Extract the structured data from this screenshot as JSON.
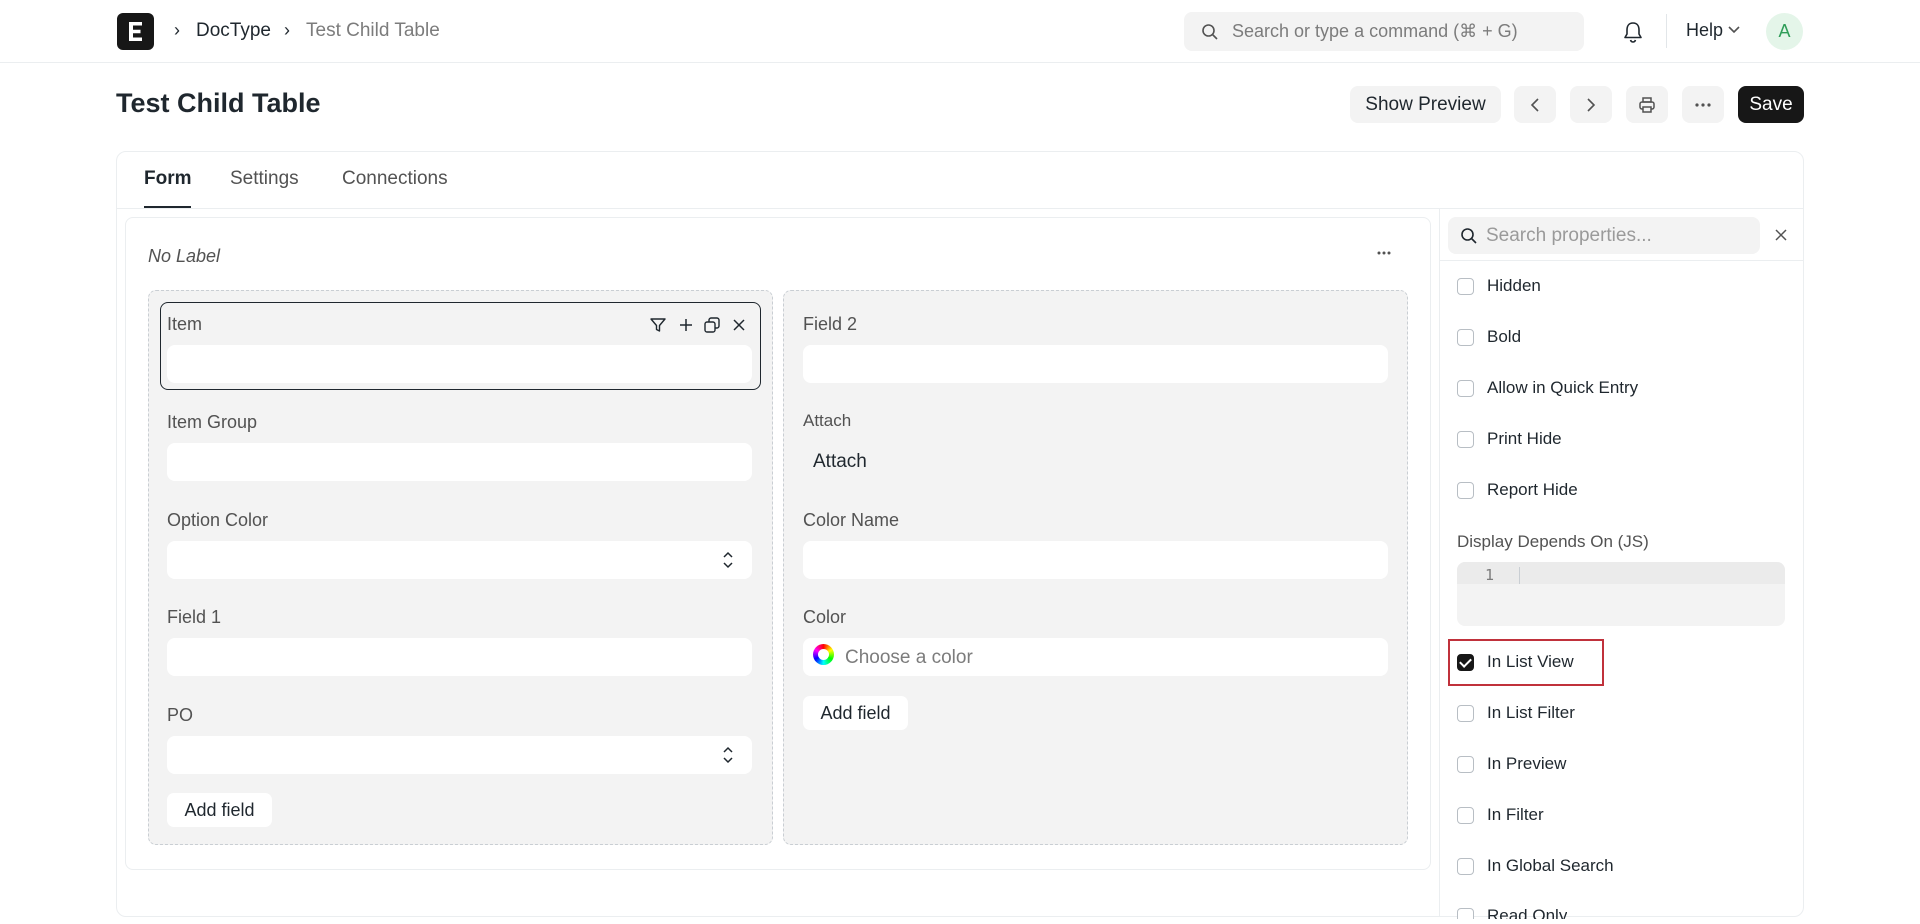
{
  "navbar": {
    "breadcrumbs": [
      "DocType",
      "Test Child Table"
    ],
    "search_placeholder": "Search or type a command (⌘ + G)",
    "help_label": "Help",
    "avatar_initial": "A"
  },
  "page": {
    "title": "Test Child Table",
    "buttons": {
      "show_preview": "Show Preview",
      "save": "Save"
    }
  },
  "tabs": [
    "Form",
    "Settings",
    "Connections"
  ],
  "active_tab": "Form",
  "section": {
    "label": "No Label",
    "column1": {
      "fields": [
        {
          "label": "Item",
          "type": "link",
          "selected": true
        },
        {
          "label": "Item Group",
          "type": "link"
        },
        {
          "label": "Option Color",
          "type": "select"
        },
        {
          "label": "Field 1",
          "type": "data"
        },
        {
          "label": "PO",
          "type": "select"
        }
      ],
      "add_field": "Add field"
    },
    "column2": {
      "fields": [
        {
          "label": "Field 2",
          "type": "data"
        },
        {
          "label": "Attach",
          "type": "attach",
          "button_label": "Attach"
        },
        {
          "label": "Color Name",
          "type": "data"
        },
        {
          "label": "Color",
          "type": "color",
          "placeholder": "Choose a color"
        }
      ],
      "add_field": "Add field"
    }
  },
  "properties": {
    "search_placeholder": "Search properties...",
    "checkboxes_top": [
      {
        "label": "Hidden",
        "checked": false
      },
      {
        "label": "Bold",
        "checked": false
      },
      {
        "label": "Allow in Quick Entry",
        "checked": false
      },
      {
        "label": "Print Hide",
        "checked": false
      },
      {
        "label": "Report Hide",
        "checked": false
      }
    ],
    "display_depends_on": {
      "label": "Display Depends On (JS)",
      "line_number": "1"
    },
    "checkboxes_bottom": [
      {
        "label": "In List View",
        "checked": true,
        "highlighted": true
      },
      {
        "label": "In List Filter",
        "checked": false
      },
      {
        "label": "In Preview",
        "checked": false
      },
      {
        "label": "In Filter",
        "checked": false
      },
      {
        "label": "In Global Search",
        "checked": false
      },
      {
        "label": "Read Only",
        "checked": false
      }
    ]
  },
  "colors": {
    "primary_dark": "#171717",
    "highlight": "#c0313b",
    "avatar_bg": "#e4f5e9",
    "avatar_fg": "#2f9d58"
  }
}
